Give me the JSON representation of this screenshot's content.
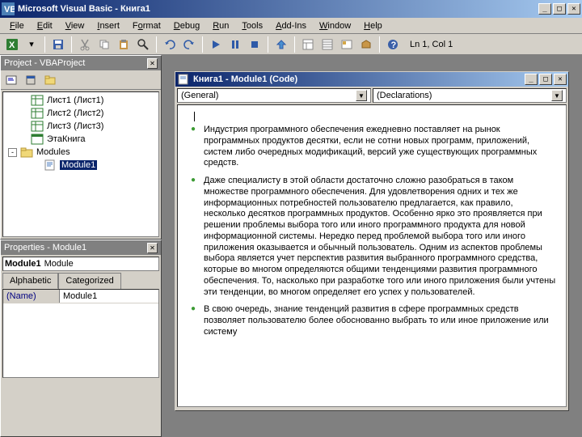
{
  "app": {
    "title": "Microsoft Visual Basic - Книга1"
  },
  "menu": [
    "File",
    "Edit",
    "View",
    "Insert",
    "Format",
    "Debug",
    "Run",
    "Tools",
    "Add-Ins",
    "Window",
    "Help"
  ],
  "toolbar": {
    "status": "Ln 1, Col 1"
  },
  "project_pane": {
    "title": "Project - VBAProject",
    "nodes": {
      "sheet1": "Лист1 (Лист1)",
      "sheet2": "Лист2 (Лист2)",
      "sheet3": "Лист3 (Лист3)",
      "thiswb": "ЭтаКнига",
      "modules": "Modules",
      "module1": "Module1"
    }
  },
  "properties_pane": {
    "title": "Properties - Module1",
    "object_bold": "Module1",
    "object_type": "Module",
    "tabs": {
      "alpha": "Alphabetic",
      "cat": "Categorized"
    },
    "rows": [
      {
        "key": "(Name)",
        "val": "Module1"
      }
    ]
  },
  "code_window": {
    "title": "Книга1 - Module1 (Code)",
    "combo_left": "(General)",
    "combo_right": "(Declarations)",
    "bullets": [
      "Индустрия программного обеспечения ежедневно поставляет на рынок программных продуктов десятки, если не сотни новых программ, приложений, систем либо очередных модификаций, версий уже существующих программных средств.",
      "Даже специалисту в этой области достаточно сложно разобраться в таком множестве программного обеспечения. Для удовлетворения одних и тех же информационных потребностей пользователю предлагается, как правило, несколько десятков программных продуктов. Особенно ярко это проявляется при решении проблемы выбора того или иного программного продукта для новой информационной системы. Нередко перед проблемой выбора того или иного приложения оказывается и обычный пользователь. Одним из аспектов проблемы выбора является учет перспектив развития выбранного программного средства, которые во многом определяются общими тенденциями развития программного обеспечения. То, насколько при разработке того или иного приложения были учтены эти тенденции, во многом определяет его успех у пользователей.",
      "В свою очередь, знание тенденций развития в сфере программных средств позволяет пользователю более обоснованно выбрать то или иное приложение или систему"
    ]
  }
}
